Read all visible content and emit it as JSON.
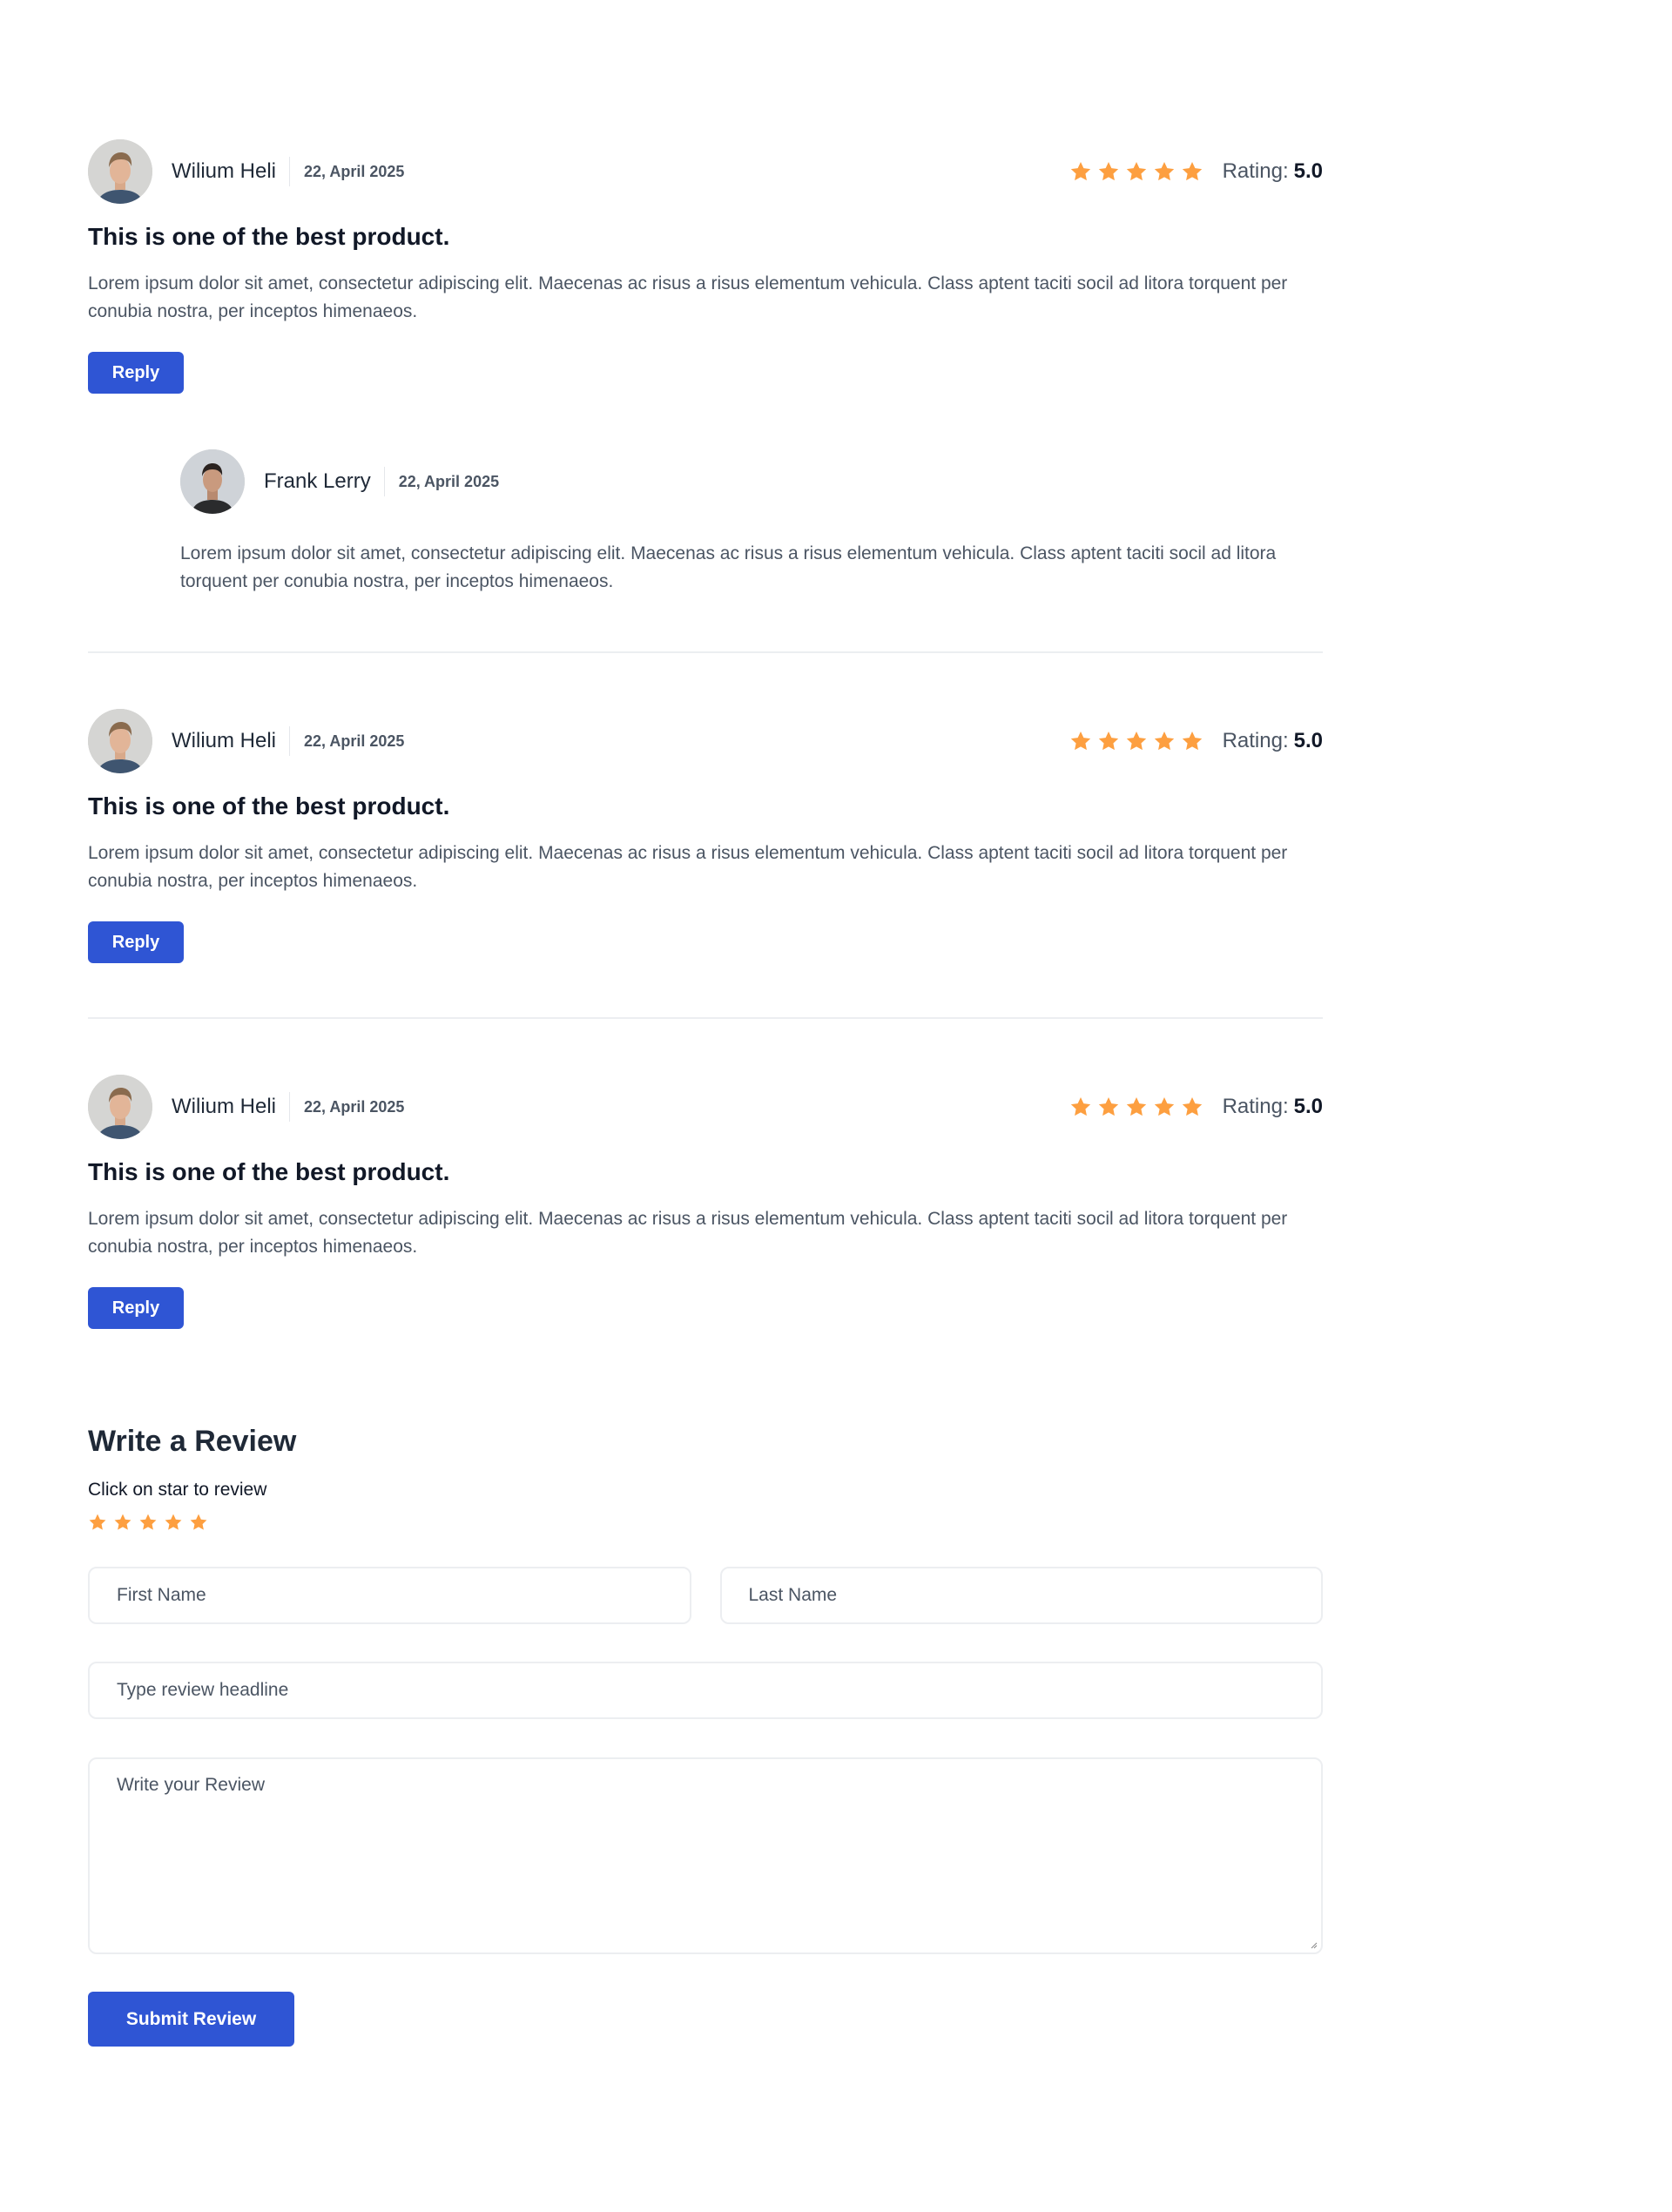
{
  "colors": {
    "accent": "#2f55d4",
    "star": "#fd9f40",
    "divider": "#eceef1"
  },
  "reviews": [
    {
      "author": "Wilium Heli",
      "date": "22, April 2025",
      "stars": 5,
      "rating_label": "Rating:",
      "rating_value": "5.0",
      "title": "This is one of the best product.",
      "body": "Lorem ipsum dolor sit amet, consectetur adipiscing elit. Maecenas ac risus a risus elementum vehicula. Class aptent taciti socil ad litora torquent per conubia nostra, per inceptos himenaeos.",
      "reply_label": "Reply",
      "replies": [
        {
          "author": "Frank Lerry",
          "date": "22, April 2025",
          "body": "Lorem ipsum dolor sit amet, consectetur adipiscing elit. Maecenas ac risus a risus elementum vehicula. Class aptent taciti socil ad litora torquent per conubia nostra, per inceptos himenaeos."
        }
      ]
    },
    {
      "author": "Wilium Heli",
      "date": "22, April 2025",
      "stars": 5,
      "rating_label": "Rating:",
      "rating_value": "5.0",
      "title": "This is one of the best product.",
      "body": "Lorem ipsum dolor sit amet, consectetur adipiscing elit. Maecenas ac risus a risus elementum vehicula. Class aptent taciti socil ad litora torquent per conubia nostra, per inceptos himenaeos.",
      "reply_label": "Reply"
    },
    {
      "author": "Wilium Heli",
      "date": "22, April 2025",
      "stars": 5,
      "rating_label": "Rating:",
      "rating_value": "5.0",
      "title": "This is one of the best product.",
      "body": "Lorem ipsum dolor sit amet, consectetur adipiscing elit. Maecenas ac risus a risus elementum vehicula. Class aptent taciti socil ad litora torquent per conubia nostra, per inceptos himenaeos.",
      "reply_label": "Reply"
    }
  ],
  "form": {
    "title": "Write a Review",
    "hint": "Click on star to review",
    "stars": 5,
    "first_name_placeholder": "First Name",
    "last_name_placeholder": "Last Name",
    "headline_placeholder": "Type review headline",
    "review_placeholder": "Write your Review",
    "submit_label": "Submit Review"
  }
}
